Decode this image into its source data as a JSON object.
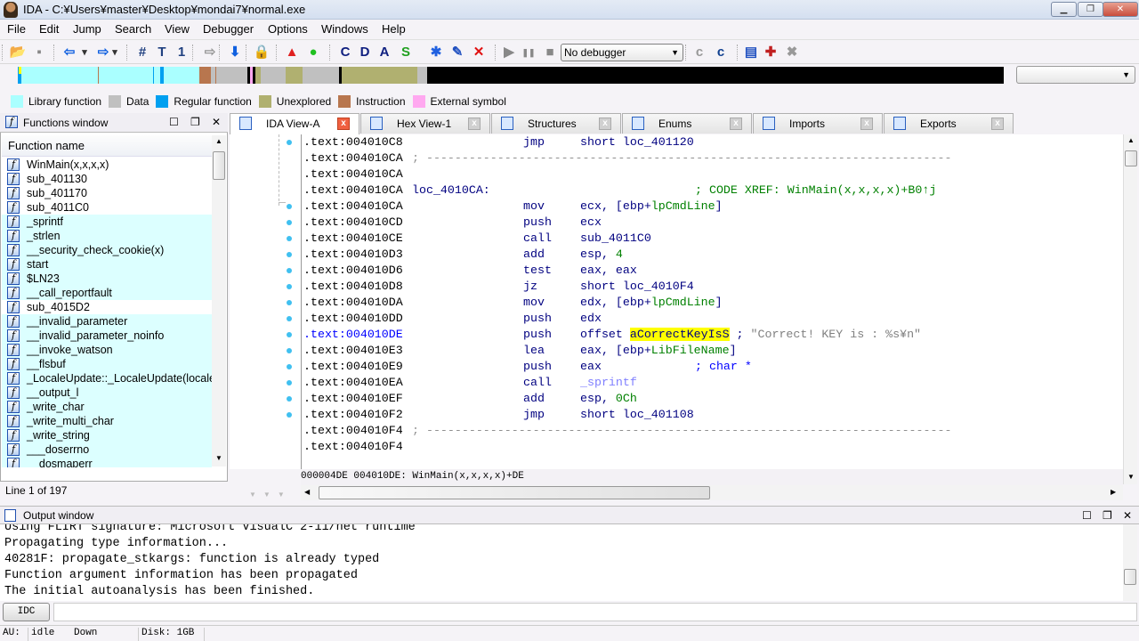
{
  "window": {
    "title": "IDA - C:¥Users¥master¥Desktop¥mondai7¥normal.exe",
    "controls": [
      "minimize",
      "maximize",
      "close"
    ]
  },
  "menu": [
    "File",
    "Edit",
    "Jump",
    "Search",
    "View",
    "Debugger",
    "Options",
    "Windows",
    "Help"
  ],
  "toolbar": {
    "icons": [
      {
        "name": "open-folder-icon",
        "g": "📂",
        "c": "#e0a020"
      },
      {
        "name": "save-icon",
        "g": "▪",
        "c": "#888"
      },
      {
        "name": "back-arrow-icon",
        "g": "⇦",
        "c": "#1060e0"
      },
      {
        "name": "back-dropdown-icon",
        "g": "▾",
        "c": "#333"
      },
      {
        "name": "forward-arrow-icon",
        "g": "⇨",
        "c": "#1060e0"
      },
      {
        "name": "forward-dropdown-icon",
        "g": "▾",
        "c": "#333"
      },
      {
        "name": "search-binary-icon",
        "g": "#",
        "c": "#204080"
      },
      {
        "name": "search-text-icon",
        "g": "T",
        "c": "#204080"
      },
      {
        "name": "search-immediate-icon",
        "g": "1",
        "c": "#204080"
      },
      {
        "name": "search-next-icon",
        "g": "⇨",
        "c": "#999"
      },
      {
        "name": "jump-down-icon",
        "g": "⬇",
        "c": "#1060e0"
      },
      {
        "name": "lock-icon",
        "g": "🔒",
        "c": "#c0a000"
      },
      {
        "name": "warning-icon",
        "g": "▲",
        "c": "#e02020"
      },
      {
        "name": "green-ball-icon",
        "g": "●",
        "c": "#20c020"
      },
      {
        "name": "create-code-icon",
        "g": "C",
        "c": "#102080"
      },
      {
        "name": "create-data-icon",
        "g": "D",
        "c": "#102080"
      },
      {
        "name": "create-ascii-icon",
        "g": "A",
        "c": "#102080"
      },
      {
        "name": "create-string-icon",
        "g": "S",
        "c": "#20a020"
      },
      {
        "name": "create-struct-icon",
        "g": "✱",
        "c": "#2060e0"
      },
      {
        "name": "rename-icon",
        "g": "✎",
        "c": "#2050c0"
      },
      {
        "name": "delete-icon",
        "g": "✕",
        "c": "#e01010"
      },
      {
        "name": "play-icon",
        "g": "▶",
        "c": "#888"
      },
      {
        "name": "pause-icon",
        "g": "❚❚",
        "c": "#888"
      },
      {
        "name": "stop-icon",
        "g": "■",
        "c": "#888"
      },
      {
        "name": "compile-icon",
        "g": "c",
        "c": "#999"
      },
      {
        "name": "run-script-icon",
        "g": "c",
        "c": "#104090"
      },
      {
        "name": "breakpoint-list-icon",
        "g": "▤",
        "c": "#2050c0"
      },
      {
        "name": "add-breakpoint-icon",
        "g": "✚",
        "c": "#c02020"
      },
      {
        "name": "delete-breakpoint-icon",
        "g": "✖",
        "c": "#999"
      }
    ],
    "debugger_select": "No debugger"
  },
  "legend": [
    {
      "label": "Library function",
      "color": "#aaffff"
    },
    {
      "label": "Data",
      "color": "#c0c0c0"
    },
    {
      "label": "Regular function",
      "color": "#00a0f0"
    },
    {
      "label": "Unexplored",
      "color": "#b0b070"
    },
    {
      "label": "Instruction",
      "color": "#b8764e"
    },
    {
      "label": "External symbol",
      "color": "#ffa8f0"
    }
  ],
  "functions": {
    "title": "Functions window",
    "column": "Function name",
    "status": "Line 1 of 197",
    "items": [
      {
        "n": "WinMain(x,x,x,x)",
        "lib": false
      },
      {
        "n": "sub_401130",
        "lib": false
      },
      {
        "n": "sub_401170",
        "lib": false
      },
      {
        "n": "sub_4011C0",
        "lib": false
      },
      {
        "n": "_sprintf",
        "lib": true
      },
      {
        "n": "_strlen",
        "lib": true
      },
      {
        "n": "__security_check_cookie(x)",
        "lib": true
      },
      {
        "n": "start",
        "lib": true
      },
      {
        "n": "$LN23",
        "lib": true
      },
      {
        "n": "__call_reportfault",
        "lib": true
      },
      {
        "n": "sub_4015D2",
        "lib": false
      },
      {
        "n": "__invalid_parameter",
        "lib": true
      },
      {
        "n": "__invalid_parameter_noinfo",
        "lib": true
      },
      {
        "n": "__invoke_watson",
        "lib": true
      },
      {
        "n": "__flsbuf",
        "lib": true
      },
      {
        "n": "_LocaleUpdate::_LocaleUpdate(locale",
        "lib": true
      },
      {
        "n": "__output_l",
        "lib": true
      },
      {
        "n": "_write_char",
        "lib": true
      },
      {
        "n": "_write_multi_char",
        "lib": true
      },
      {
        "n": "_write_string",
        "lib": true
      },
      {
        "n": "___doserrno",
        "lib": true
      },
      {
        "n": "__dosmaperr",
        "lib": true
      }
    ]
  },
  "tabs": [
    "IDA View-A",
    "Hex View-1",
    "Structures",
    "Enums",
    "Imports",
    "Exports"
  ],
  "code": {
    "lines": [
      {
        "a": ".text:004010C8",
        "mn": "jmp",
        "op": [
          [
            "short loc_401120",
            ""
          ]
        ]
      },
      {
        "a": ".text:004010CA",
        "sep": true
      },
      {
        "a": ".text:004010CA"
      },
      {
        "a": ".text:004010CA",
        "lbl": "loc_4010CA:",
        "cm": [
          [
            "; CODE XREF: WinMain(x,x,x,x)+B0↑j",
            "g"
          ]
        ]
      },
      {
        "a": ".text:004010CA",
        "mn": "mov",
        "op": [
          [
            "ecx, [ebp+",
            ""
          ],
          [
            "lpCmdLine",
            "g"
          ],
          [
            "]",
            ""
          ]
        ]
      },
      {
        "a": ".text:004010CD",
        "mn": "push",
        "op": [
          [
            "ecx",
            ""
          ]
        ]
      },
      {
        "a": ".text:004010CE",
        "mn": "call",
        "op": [
          [
            "sub_4011C0",
            ""
          ]
        ]
      },
      {
        "a": ".text:004010D3",
        "mn": "add",
        "op": [
          [
            "esp, ",
            ""
          ],
          [
            "4",
            "g"
          ]
        ]
      },
      {
        "a": ".text:004010D6",
        "mn": "test",
        "op": [
          [
            "eax, eax",
            ""
          ]
        ]
      },
      {
        "a": ".text:004010D8",
        "mn": "jz",
        "op": [
          [
            "short loc_4010F4",
            ""
          ]
        ]
      },
      {
        "a": ".text:004010DA",
        "mn": "mov",
        "op": [
          [
            "edx, [ebp+",
            ""
          ],
          [
            "lpCmdLine",
            "g"
          ],
          [
            "]",
            ""
          ]
        ]
      },
      {
        "a": ".text:004010DD",
        "mn": "push",
        "op": [
          [
            "edx",
            ""
          ]
        ]
      },
      {
        "a": ".text:004010DE",
        "cur": true,
        "mn": "push",
        "op": [
          [
            "offset ",
            ""
          ],
          [
            "aCorrectKeyIsS",
            "hl"
          ],
          [
            " ; ",
            ""
          ],
          [
            "\"Correct! KEY is : %s¥n\"",
            "str"
          ]
        ]
      },
      {
        "a": ".text:004010E3",
        "mn": "lea",
        "op": [
          [
            "eax, [ebp+",
            ""
          ],
          [
            "LibFileName",
            "g"
          ],
          [
            "]",
            ""
          ]
        ]
      },
      {
        "a": ".text:004010E9",
        "mn": "push",
        "op": [
          [
            "eax",
            ""
          ]
        ],
        "cm": [
          [
            "; char *",
            "bl"
          ]
        ]
      },
      {
        "a": ".text:004010EA",
        "mn": "call",
        "op": [
          [
            "_sprintf",
            "lib2"
          ]
        ]
      },
      {
        "a": ".text:004010EF",
        "mn": "add",
        "op": [
          [
            "esp, ",
            ""
          ],
          [
            "0Ch",
            "g"
          ]
        ]
      },
      {
        "a": ".text:004010F2",
        "mn": "jmp",
        "op": [
          [
            "short loc_401108",
            ""
          ]
        ]
      },
      {
        "a": ".text:004010F4",
        "sep": true
      },
      {
        "a": ".text:004010F4"
      }
    ],
    "status": "000004DE 004010DE: WinMain(x,x,x,x)+DE"
  },
  "output": {
    "title": "Output window",
    "lines": [
      "Using FLIRT signature: Microsoft VisualC 2-11/net runtime",
      "Propagating type information...",
      "40281F: propagate_stkargs: function is already typed",
      "Function argument information has been propagated",
      "The initial autoanalysis has been finished."
    ],
    "idc_button": "IDC",
    "idc_value": ""
  },
  "statusbar": {
    "au": "AU:",
    "state": "idle",
    "direction": "Down",
    "disk": "Disk: 1GB"
  }
}
